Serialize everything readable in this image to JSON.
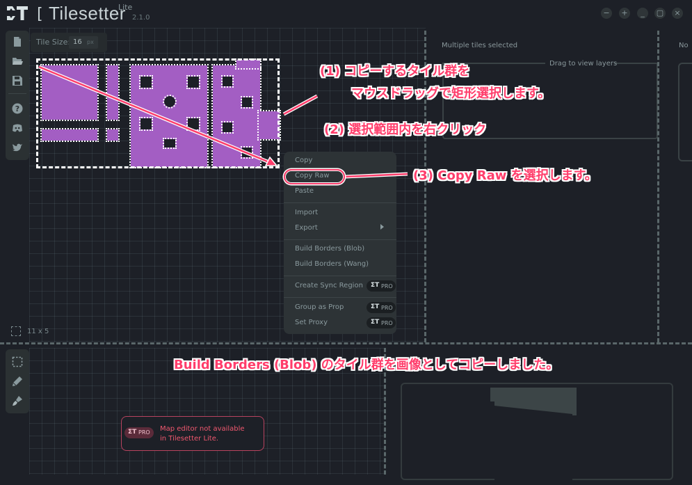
{
  "window": {
    "app_name": "Tilesetter",
    "edition": "Lite",
    "version": "2.1.0",
    "bracket": "[",
    "buttons": [
      "−",
      "+",
      "_",
      "▢",
      "×"
    ]
  },
  "left_toolbar": {
    "icons": [
      "new-file-icon",
      "open-folder-icon",
      "save-icon",
      "help-icon",
      "discord-icon",
      "twitter-icon"
    ]
  },
  "canvas": {
    "tile_size_label": "Tile Size:",
    "tile_size_value": "16",
    "tile_size_unit": "px",
    "selection_dimensions": "11 x 5"
  },
  "right_panel": {
    "selection_status": "Multiple tiles selected",
    "drag_hint": "Drag to view layers",
    "far_right_label": "No"
  },
  "context_menu": {
    "items": [
      {
        "label": "Copy"
      },
      {
        "label": "Copy Raw"
      },
      {
        "label": "Paste"
      },
      {
        "label": "Import"
      },
      {
        "label": "Export"
      },
      {
        "label": "Build Borders (Blob)"
      },
      {
        "label": "Build Borders (Wang)"
      },
      {
        "label": "Create Sync Region"
      },
      {
        "label": "Group as Prop"
      },
      {
        "label": "Set Proxy"
      }
    ],
    "pro_badge_text": "PRO",
    "pro_badge_logo": "ΣT"
  },
  "bottom_toolbar": {
    "icons": [
      "select-icon",
      "pencil-icon",
      "brush-icon"
    ]
  },
  "map_editor": {
    "message": "Map editor not available\nin Tilesetter Lite.",
    "badge_logo": "ΣT",
    "badge_text": "PRO"
  },
  "annotations": {
    "step1_line1": "(1) コピーするタイル群を",
    "step1_line2": "マウスドラッグで矩形選択します。",
    "step2": "(2) 選択範囲内を右クリック",
    "step3": "(3) Copy Raw を選択します。",
    "result": "Build Borders (Blob) のタイル群を画像としてコピーしました。"
  },
  "colors": {
    "background": "#1d2027",
    "panel": "#2b3133",
    "tile_purple": "#a35ec3",
    "annotation_pink": "#ff3d6b",
    "pro_red": "#f0586f"
  }
}
